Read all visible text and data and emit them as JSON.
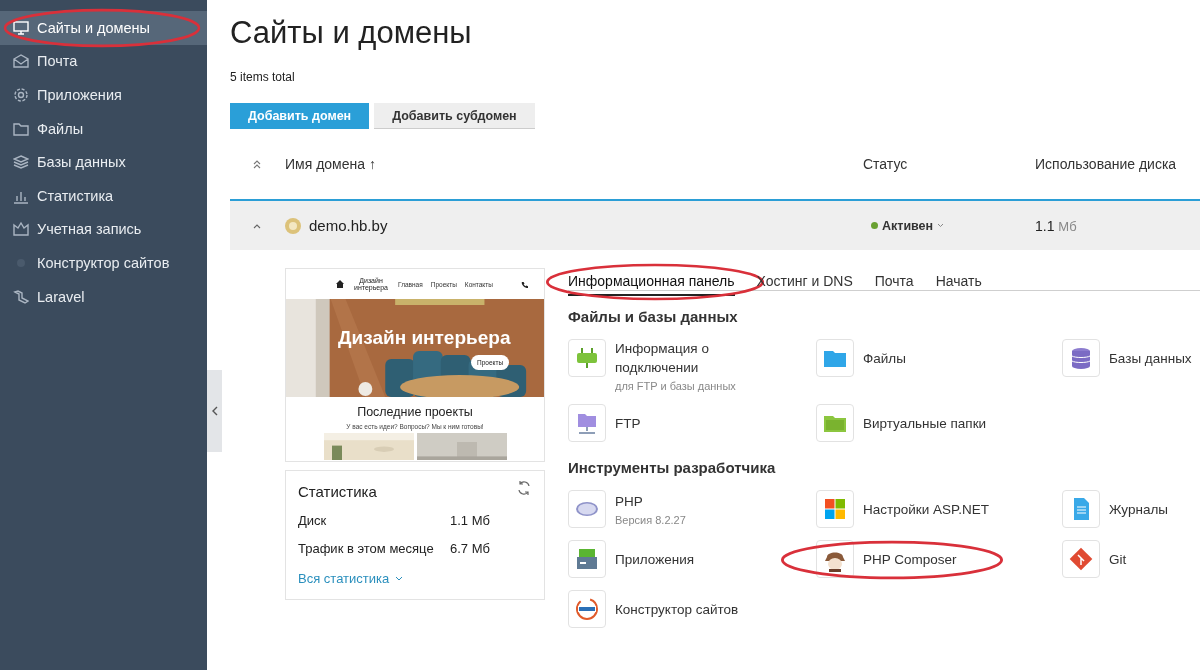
{
  "sidebar": {
    "items": [
      {
        "label": "Сайты и домены",
        "selected": true,
        "highlighted": true
      },
      {
        "label": "Почта",
        "selected": false,
        "highlighted": false
      },
      {
        "label": "Приложения",
        "selected": false,
        "highlighted": false
      },
      {
        "label": "Файлы",
        "selected": false,
        "highlighted": false
      },
      {
        "label": "Базы данных",
        "selected": false,
        "highlighted": false
      },
      {
        "label": "Статистика",
        "selected": false,
        "highlighted": false
      },
      {
        "label": "Учетная запись",
        "selected": false,
        "highlighted": false
      },
      {
        "label": "Конструктор сайтов",
        "selected": false,
        "highlighted": false
      },
      {
        "label": "Laravel",
        "selected": false,
        "highlighted": false
      }
    ]
  },
  "page": {
    "title": "Сайты и домены",
    "count": "5 items total"
  },
  "buttons": [
    {
      "label": "Добавить домен",
      "kind": "primary"
    },
    {
      "label": "Добавить субдомен",
      "kind": "secondary"
    }
  ],
  "table": {
    "columns": [
      "Имя домена ↑",
      "Статус",
      "Использование диска"
    ],
    "rows": [
      {
        "domain": "demo.hb.by",
        "status": "Активен",
        "disk_value": "1.1",
        "disk_unit": "Мб",
        "expanded": true
      }
    ]
  },
  "preview": {
    "site_title": "Дизайн интерьера",
    "nav": [
      "Главная",
      "Проекты",
      "Контакты"
    ],
    "hero_title": "Дизайн интерьера",
    "hero_button": "Проекты",
    "section_title": "Последние проекты",
    "section_subtitle": "У вас есть идеи? Вопросы? Мы к ним готовы!"
  },
  "stats": {
    "title": "Статистика",
    "rows": [
      {
        "label": "Диск",
        "value": "1.1 Мб"
      },
      {
        "label": "Трафик в этом месяце",
        "value": "6.7 Мб"
      }
    ],
    "link": "Вся статистика"
  },
  "tabs": [
    {
      "label": "Информационная панель",
      "selected": true,
      "highlighted": true
    },
    {
      "label": "Хостинг и DNS",
      "selected": false,
      "highlighted": false
    },
    {
      "label": "Почта",
      "selected": false,
      "highlighted": false
    },
    {
      "label": "Начать",
      "selected": false,
      "highlighted": false
    }
  ],
  "sections": [
    {
      "title": "Файлы и базы данных",
      "items": [
        {
          "label": "Информация о подключении",
          "sublabel": "для FTP и базы данных",
          "highlighted": false
        },
        {
          "label": "Файлы",
          "highlighted": false
        },
        {
          "label": "Базы данных",
          "highlighted": false
        },
        {
          "label": "FTP",
          "highlighted": false
        },
        {
          "label": "Виртуальные папки",
          "highlighted": false
        }
      ]
    },
    {
      "title": "Инструменты разработчика",
      "items": [
        {
          "label": "PHP",
          "sublabel": "Версия 8.2.27",
          "highlighted": false
        },
        {
          "label": "Настройки ASP.NET",
          "highlighted": false
        },
        {
          "label": "Журналы",
          "highlighted": false
        },
        {
          "label": "Приложения",
          "highlighted": false
        },
        {
          "label": "PHP Composer",
          "highlighted": true
        },
        {
          "label": "Git",
          "highlighted": false
        },
        {
          "label": "Конструктор сайтов",
          "highlighted": false
        }
      ]
    }
  ]
}
